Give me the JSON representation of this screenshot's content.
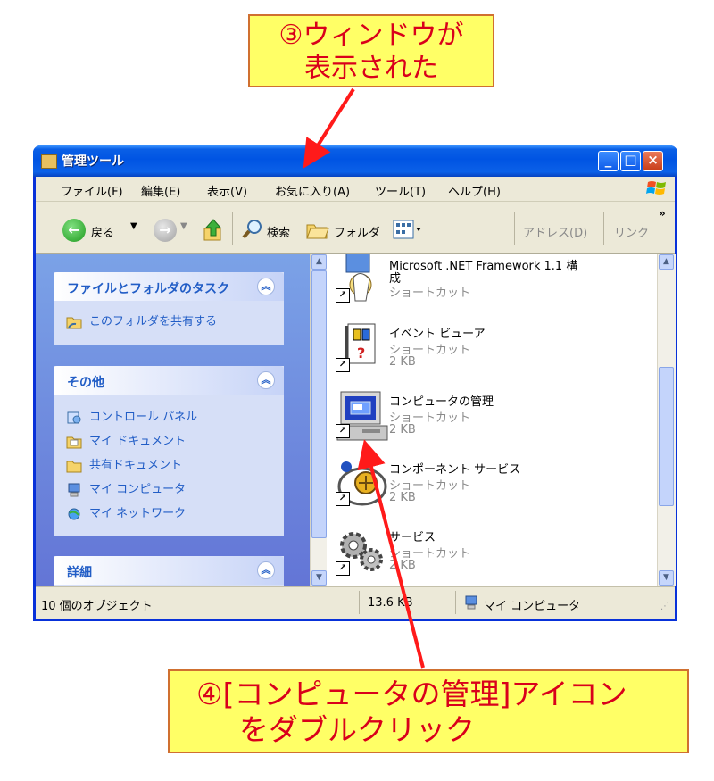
{
  "callouts": {
    "top": {
      "line1": "③ウィンドウが",
      "line2": "表示された"
    },
    "bottom": {
      "line1": "④[コンピュータの管理]アイコン",
      "line2": "をダブルクリック"
    }
  },
  "window": {
    "title": "管理ツール",
    "controls": {
      "minimize": "_",
      "maximize": "□",
      "close": "×"
    }
  },
  "menu": {
    "items": [
      "ファイル(F)",
      "編集(E)",
      "表示(V)",
      "お気に入り(A)",
      "ツール(T)",
      "ヘルプ(H)"
    ]
  },
  "toolbar": {
    "back": "戻る",
    "search": "検索",
    "folders": "フォルダ",
    "address": "アドレス(D)",
    "links": "リンク",
    "more": "»"
  },
  "tasks": {
    "file_folder": {
      "title": "ファイルとフォルダのタスク",
      "items": [
        {
          "label": "このフォルダを共有する",
          "icon": "share-folder-icon"
        }
      ]
    },
    "other": {
      "title": "その他",
      "items": [
        {
          "label": "コントロール パネル",
          "icon": "control-panel-icon"
        },
        {
          "label": "マイ ドキュメント",
          "icon": "my-documents-icon"
        },
        {
          "label": "共有ドキュメント",
          "icon": "shared-documents-icon"
        },
        {
          "label": "マイ コンピュータ",
          "icon": "my-computer-icon"
        },
        {
          "label": "マイ ネットワーク",
          "icon": "my-network-icon"
        }
      ]
    },
    "details": {
      "title": "詳細"
    }
  },
  "files": [
    {
      "name": "Microsoft .NET Framework 1.1 構",
      "name2": "成",
      "type": "ショートカット",
      "size": "",
      "icon": "dotnet-config-icon"
    },
    {
      "name": "イベント ビューア",
      "type": "ショートカット",
      "size": "2 KB",
      "icon": "event-viewer-icon"
    },
    {
      "name": "コンピュータの管理",
      "type": "ショートカット",
      "size": "2 KB",
      "icon": "computer-management-icon"
    },
    {
      "name": "コンポーネント サービス",
      "type": "ショートカット",
      "size": "2 KB",
      "icon": "component-services-icon"
    },
    {
      "name": "サービス",
      "type": "ショートカット",
      "size": "2 KB",
      "icon": "services-icon"
    }
  ],
  "status": {
    "objects": "10 個のオブジェクト",
    "size": "13.6 KB",
    "location": "マイ コンピュータ"
  },
  "colors": {
    "callout_bg": "#ffff66",
    "callout_text": "#d9001b",
    "arrow": "#ff1a1a",
    "titlebar": "#0054e3",
    "taskpane": "#6375d6"
  }
}
